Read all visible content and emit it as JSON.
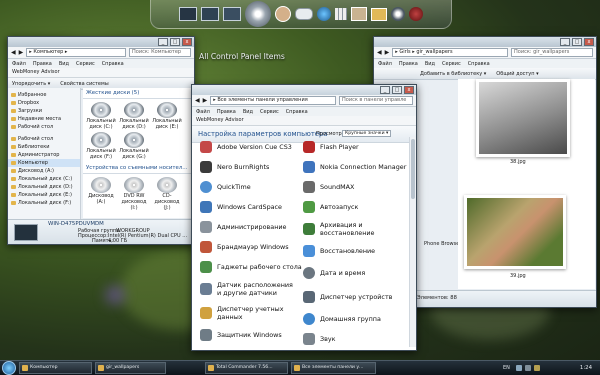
{
  "desktop": {
    "caption": "All Control Panel Items"
  },
  "left_window": {
    "address": "▸ Компьютер ▸",
    "search": "Поиск: Компьютер",
    "menu": [
      "Файл",
      "Правка",
      "Вид",
      "Сервис",
      "Справка"
    ],
    "app_bar": "WebMoney Advisor",
    "toolbar": [
      "Упорядочить ▾",
      "Свойства системы"
    ],
    "nav": [
      {
        "label": "Избранное",
        "sel": false
      },
      {
        "label": "Dropbox",
        "sel": false
      },
      {
        "label": "Загрузки",
        "sel": false
      },
      {
        "label": "Недавние места",
        "sel": false
      },
      {
        "label": "Рабочий стол",
        "sel": false
      },
      {
        "label": "Рабочий стол",
        "sel": false
      },
      {
        "label": "Библиотеки",
        "sel": false
      },
      {
        "label": "Администратор",
        "sel": false
      },
      {
        "label": "Компьютер",
        "sel": true
      },
      {
        "label": "Дисковод (A:)",
        "sel": false
      },
      {
        "label": "Локальный диск (C:)",
        "sel": false
      },
      {
        "label": "Локальный диск (D:)",
        "sel": false
      },
      {
        "label": "Локальный диск (E:)",
        "sel": false
      },
      {
        "label": "Локальный диск (F:)",
        "sel": false
      }
    ],
    "hdd_group": "Жесткие диски (5)",
    "hdd": [
      "Локальный диск (C:)",
      "Локальный диск (D:)",
      "Локальный диск (E:)",
      "Локальный диск (F:)",
      "Локальный диск (G:)"
    ],
    "removable_group": "Устройства со съемными носител...",
    "removable": [
      "Дисковод (A:)",
      "DVD RW дисковод (I:)",
      "CD-дисковод (J:)"
    ],
    "details": {
      "computer_name": "WIN-D475PDUVMDM",
      "workgroup_label": "Рабочая группа:",
      "workgroup": "WORKGROUP",
      "cpu_label": "Процессор:",
      "cpu": "Intel(R) Pentium(R) Dual CPU ...",
      "memory_label": "Память:",
      "memory": "4,00 ГБ"
    }
  },
  "cp_window": {
    "address": "▸ Все элементы панели управления",
    "search": "Поиск в панели управле",
    "menu": [
      "Файл",
      "Правка",
      "Вид",
      "Сервис",
      "Справка"
    ],
    "app_bar": "WebMoney Advisor",
    "heading": "Настройка параметров компьютера",
    "view_label": "Просмотр:",
    "view_value": "Крупные значки ▾",
    "left_items": [
      {
        "label": "Adobe Version Cue CS3",
        "color": "#c44848"
      },
      {
        "label": "Nero BurnRights",
        "color": "#3b3b3b"
      },
      {
        "label": "QuickTime",
        "color": "#4f8fd1"
      },
      {
        "label": "Windows CardSpace",
        "color": "#3f76b8"
      },
      {
        "label": "Администрирование",
        "color": "#8a939c"
      },
      {
        "label": "Брандмауэр Windows",
        "color": "#c0563a"
      },
      {
        "label": "Гаджеты рабочего стола",
        "color": "#4c8f49"
      },
      {
        "label": "Датчик расположения и другие датчики",
        "color": "#6a7d93"
      },
      {
        "label": "Диспетчер учетных данных",
        "color": "#d0a13f"
      },
      {
        "label": "Защитник Windows",
        "color": "#6f7c86"
      }
    ],
    "right_items": [
      {
        "label": "Flash Player",
        "color": "#b72828"
      },
      {
        "label": "Nokia Connection Manager",
        "color": "#3f74bd"
      },
      {
        "label": "SoundMAX",
        "color": "#6a6a6a"
      },
      {
        "label": "Автозапуск",
        "color": "#4f9a43"
      },
      {
        "label": "Архивация и восстановление",
        "color": "#3e7d3a"
      },
      {
        "label": "Восстановление",
        "color": "#4a8fd8"
      },
      {
        "label": "Дата и время",
        "color": "#6b7680"
      },
      {
        "label": "Диспетчер устройств",
        "color": "#596775"
      },
      {
        "label": "Домашняя группа",
        "color": "#3f87cd"
      },
      {
        "label": "Звук",
        "color": "#7a848d"
      }
    ]
  },
  "right_window": {
    "address": "▸ Girls ▸ gir_wallpapers",
    "search": "Поиск: gir_wallpapers",
    "menu": [
      "Файл",
      "Правка",
      "Вид",
      "Сервис",
      "Справка"
    ],
    "toolbar": [
      "Добавить в библиотеку ▾",
      "Общий доступ ▾"
    ],
    "photo_labels": [
      "38.jpg",
      "39.jpg"
    ],
    "side_fragment": "Phone Browser",
    "status": "Элементов: 88"
  },
  "taskbar": {
    "tasks": [
      "Компьютер",
      "gir_wallpapers",
      "Total Commander 7.56...",
      "Все элементы панели у..."
    ],
    "lang": "EN",
    "clock": "1:24"
  },
  "colors": {
    "accent": "#3a6fb0",
    "taskbar": "#121a20"
  }
}
